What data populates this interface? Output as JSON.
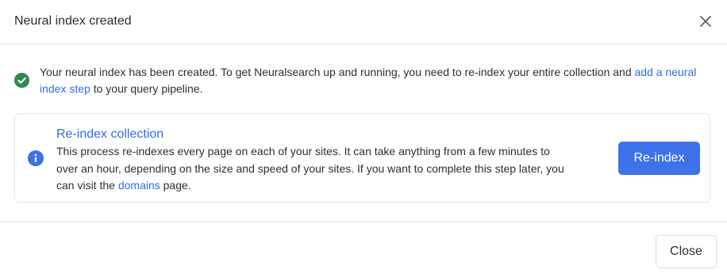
{
  "modal": {
    "title": "Neural index created",
    "close_icon": "close-icon"
  },
  "success": {
    "icon": "check-circle-icon",
    "icon_color": "#2e8a4f",
    "text_before_link": "Your neural index has been created. To get Neuralsearch up and running, you need to re-index your entire collection and ",
    "link_text": "add a neural index step",
    "text_after_link": " to your query pipeline."
  },
  "reindex_card": {
    "icon": "info-circle-icon",
    "icon_color": "#3e72e8",
    "title": "Re-index collection",
    "text_before_link": "This process re-indexes every page on each of your sites. It can take anything from a few minutes to over an hour, depending on the size and speed of your sites. If you want to complete this step later, you can visit the ",
    "link_text": "domains",
    "text_after_link": " page.",
    "button_label": "Re-index"
  },
  "footer": {
    "close_label": "Close"
  },
  "colors": {
    "accent": "#3e72e8",
    "link": "#2f6fe4",
    "success": "#2e8a4f",
    "border": "#e3e6ea"
  }
}
